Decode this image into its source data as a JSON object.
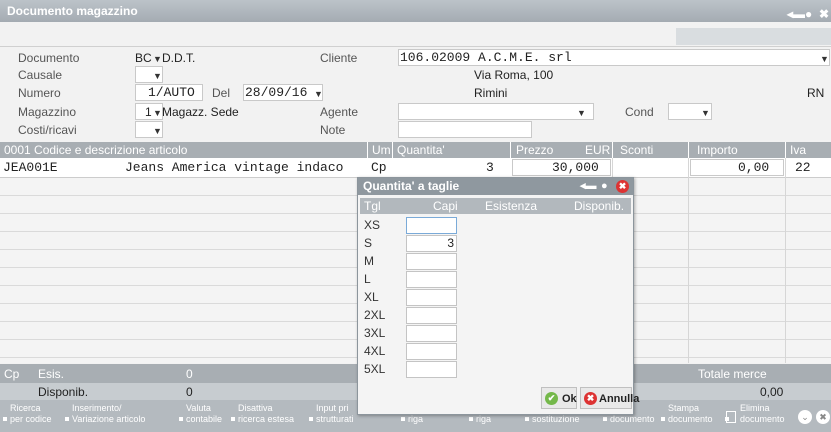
{
  "window": {
    "title": "Documento magazzino"
  },
  "header": {
    "documento_label": "Documento",
    "documento_value": "BC",
    "documento_type": "D.D.T.",
    "cliente_label": "Cliente",
    "cliente_value": "106.02009 A.C.M.E. srl",
    "address_street": "Via Roma, 100",
    "address_city": "Rimini",
    "address_province": "RN",
    "causale_label": "Causale",
    "numero_label": "Numero",
    "numero_value": "1/AUTO",
    "del_label": "Del",
    "del_value": "28/09/16",
    "magazzino_label": "Magazzino",
    "magazzino_num": "1",
    "magazzino_value": "Magazz. Sede",
    "agente_label": "Agente",
    "cond_label": "Cond",
    "costi_label": "Costi/ricavi",
    "note_label": "Note"
  },
  "grid": {
    "columns": {
      "codice": "0001  Codice e descrizione articolo",
      "um": "Um",
      "quantita": "Quantita'",
      "prezzo": "Prezzo",
      "eur": "EUR",
      "sconti": "Sconti",
      "importo": "Importo",
      "iva": "Iva"
    },
    "row": {
      "codice": "JEA001E",
      "descrizione": "Jeans America vintage indaco",
      "um": "Cp",
      "quantita": "3",
      "prezzo": "30,000",
      "importo": "0,00",
      "iva": "22"
    }
  },
  "footer": {
    "um": "Cp",
    "esis_label": "Esis.",
    "esis_value": "0",
    "disponib_label": "Disponib.",
    "disponib_value": "0",
    "totale_label": "Totale merce",
    "totale_value": "0,00"
  },
  "toolbar": {
    "b1_l1": "Ricerca",
    "b1_l2": "per codice",
    "b2_l1": "Inserimento/",
    "b2_l2": "Variazione articolo",
    "b3_l1": "Valuta",
    "b3_l2": "contabile",
    "b4_l1": "Disattiva",
    "b4_l2": "ricerca estesa",
    "b5_l1": "Input pri",
    "b5_l2": "strutturati",
    "b6_l2": "riga",
    "b7_l2": "riga",
    "b8_l2": "sostituzione",
    "b9_l2": "documento",
    "b10_l1": "Stampa",
    "b10_l2": "documento",
    "b11_l1": "Elimina",
    "b11_l2": "documento"
  },
  "dialog": {
    "title": "Quantita' a taglie",
    "col_tgl": "Tgl",
    "col_capi": "Capi",
    "col_esistenza": "Esistenza",
    "col_disponib": "Disponib.",
    "rows": [
      {
        "tgl": "XS",
        "capi": ""
      },
      {
        "tgl": "S",
        "capi": "3"
      },
      {
        "tgl": "M",
        "capi": ""
      },
      {
        "tgl": "L",
        "capi": ""
      },
      {
        "tgl": "XL",
        "capi": ""
      },
      {
        "tgl": "2XL",
        "capi": ""
      },
      {
        "tgl": "3XL",
        "capi": ""
      },
      {
        "tgl": "4XL",
        "capi": ""
      },
      {
        "tgl": "5XL",
        "capi": ""
      }
    ],
    "ok_label": "Ok",
    "annulla_label": "Annulla"
  }
}
